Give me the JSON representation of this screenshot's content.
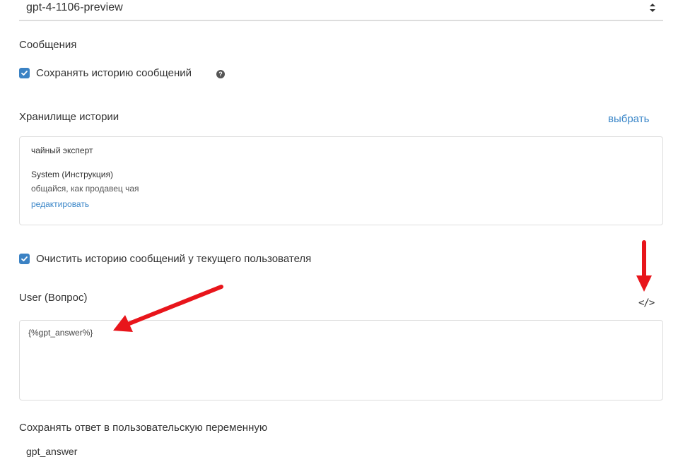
{
  "model_select": {
    "value": "gpt-4-1106-preview"
  },
  "messages_section": {
    "title": "Сообщения",
    "save_history_label": "Сохранять историю сообщений",
    "save_history_checked": true
  },
  "history_storage": {
    "title": "Хранилище истории",
    "choose_link": "выбрать",
    "item": {
      "name": "чайный эксперт",
      "role": "System (Инструкция)",
      "text": "общайся, как продавец чая",
      "edit_link": "редактировать"
    }
  },
  "clear_history": {
    "label": "Очистить историю сообщений у текущего пользователя",
    "checked": true
  },
  "user_question": {
    "title": "User (Вопрос)",
    "code_toggle": "</>",
    "value": "{%gpt_answer%}"
  },
  "save_answer": {
    "title": "Сохранять ответ в пользовательскую переменную",
    "value": "gpt_answer"
  },
  "colors": {
    "accent": "#3a86c8",
    "checkbox": "#3b82c4",
    "annotation": "#e8151b"
  },
  "icons": {
    "select": "updown-arrows-icon",
    "help": "question-circle-icon",
    "check": "checkmark-icon"
  }
}
